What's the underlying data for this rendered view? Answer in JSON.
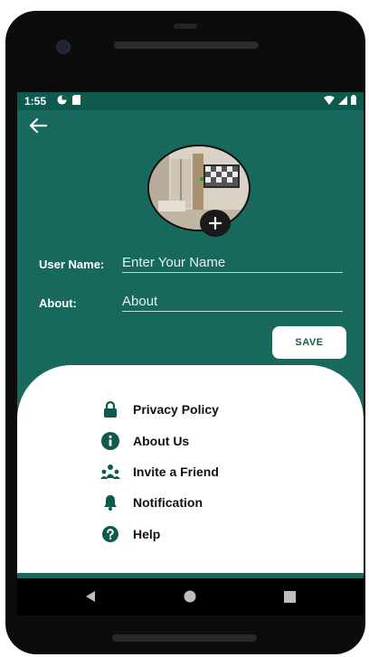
{
  "status_bar": {
    "time": "1:55"
  },
  "header": {
    "back_icon": "arrow-left-icon"
  },
  "profile": {
    "add_photo_icon": "plus-icon",
    "username_label": "User Name:",
    "username_placeholder": "Enter Your Name",
    "about_label": "About:",
    "about_placeholder": "About",
    "save_label": "SAVE"
  },
  "menu": {
    "items": [
      {
        "label": "Privacy Policy",
        "icon": "lock-icon"
      },
      {
        "label": "About Us",
        "icon": "info-icon"
      },
      {
        "label": "Invite a Friend",
        "icon": "people-icon"
      },
      {
        "label": "Notification",
        "icon": "bell-icon"
      },
      {
        "label": "Help",
        "icon": "help-icon"
      }
    ]
  },
  "colors": {
    "primary": "#16695c",
    "status_bar": "#0f5a4e",
    "sheet": "#ffffff",
    "icon": "#0f5a4e"
  }
}
